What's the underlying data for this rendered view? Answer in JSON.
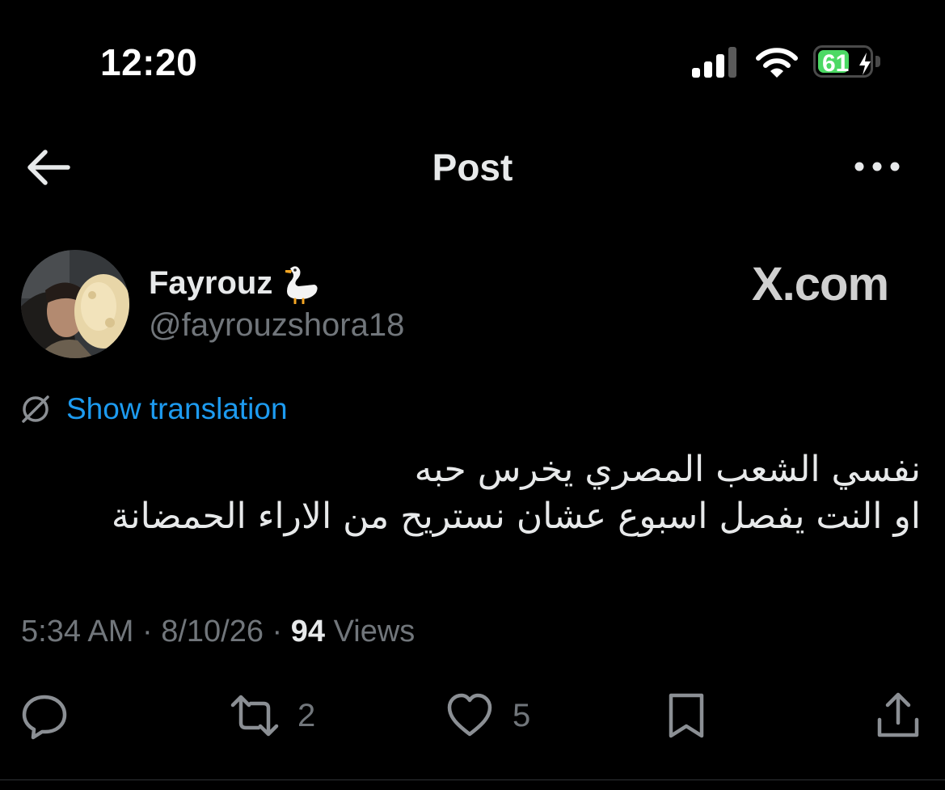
{
  "status_bar": {
    "time": "12:20",
    "battery_level": "61",
    "battery_fraction": 0.61,
    "battery_color": "#4cd964",
    "icons": [
      "cellular-signal-icon",
      "wifi-icon",
      "battery-charging-icon"
    ]
  },
  "header": {
    "title": "Post",
    "back_icon": "arrow-left-icon",
    "more_icon": "more-horizontal-icon"
  },
  "author": {
    "display_name": "Fayrouz",
    "name_emoji": "goose-emoji",
    "handle": "@fayrouzshora18",
    "avatar": "profile-photo"
  },
  "watermark": "X.com",
  "translation": {
    "label": "Show translation",
    "icon": "translate-globe-icon",
    "color": "#1d9bf0"
  },
  "post": {
    "lines": [
      "نفسي الشعب المصري يخرس حبه",
      "او النت يفصل اسبوع عشان نستريح من الاراء الحمضانة"
    ]
  },
  "meta": {
    "time": "5:34 AM",
    "separator": " · ",
    "date": "8/10/26",
    "views_count": "94",
    "views_label": "Views"
  },
  "actions": {
    "reply": {
      "icon": "reply-icon",
      "count": ""
    },
    "repost": {
      "icon": "repost-icon",
      "count": "2"
    },
    "like": {
      "icon": "heart-icon",
      "count": "5"
    },
    "bookmark": {
      "icon": "bookmark-icon",
      "count": ""
    },
    "share": {
      "icon": "share-icon",
      "count": ""
    }
  },
  "colors": {
    "background": "#000000",
    "primary_text": "#e7e9ea",
    "secondary_text": "#71767b",
    "link": "#1d9bf0"
  }
}
